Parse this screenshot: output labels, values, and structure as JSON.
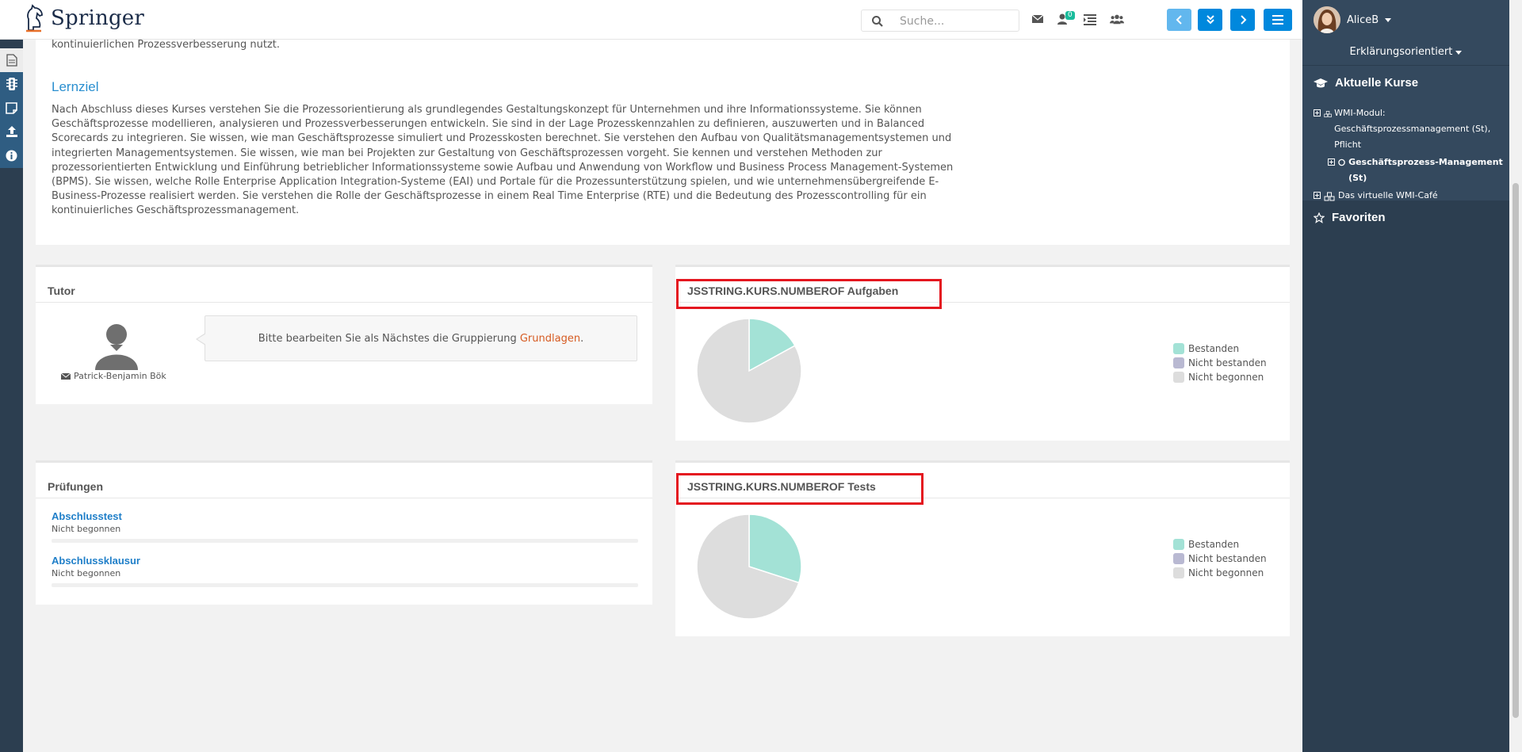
{
  "header": {
    "logo_text": "Springer",
    "search_placeholder": "Suche...",
    "notification_count": "0"
  },
  "intro": {
    "cut_text": "kontinuierlichen Prozessverbesserung nutzt.",
    "heading": "Lernziel",
    "body": "Nach Abschluss dieses Kurses verstehen Sie die Prozessorientierung als grundlegendes Gestaltungskonzept für Unternehmen und ihre Informationssysteme. Sie können Geschäftsprozesse modellieren, analysieren und Prozessverbesserungen entwickeln. Sie sind in der Lage Prozesskennzahlen zu definieren, auszuwerten und in Balanced Scorecards zu integrieren. Sie wissen, wie man Geschäftsprozesse simuliert und Prozesskosten berechnet. Sie verstehen den Aufbau von Qualitätsmanagementsystemen und integrierten Managementsystemen. Sie wissen, wie man bei Projekten zur Gestaltung von Geschäftsprozessen vorgeht. Sie kennen und verstehen Methoden zur prozessorientierten Entwicklung und Einführung betrieblicher Informationssysteme sowie Aufbau und Anwendung von Workflow und Business Process Management-Systemen (BPMS). Sie wissen, welche Rolle Enterprise Application Integration-Systeme (EAI) und Portale für die Prozessunterstützung spielen, und wie unternehmensübergreifende E-Business-Prozesse realisiert werden. Sie verstehen die Rolle der Geschäftsprozesse in einem Real Time Enterprise (RTE) und die Bedeutung des Prozesscontrolling für ein kontinuierliches Geschäftsprozessmanagement."
  },
  "tutor": {
    "title": "Tutor",
    "name": "Patrick-Benjamin Bök",
    "message_prefix": "Bitte bearbeiten Sie als Nächstes die Gruppierung ",
    "message_link": "Grundlagen",
    "message_suffix": "."
  },
  "exams": {
    "title": "Prüfungen",
    "items": [
      {
        "name": "Abschlusstest",
        "status": "Nicht begonnen",
        "progress": 0
      },
      {
        "name": "Abschlussklausur",
        "status": "Nicht begonnen",
        "progress": 0
      }
    ]
  },
  "colors": {
    "passed": "#a3e2d6",
    "failed": "#b9b9d2",
    "not_started": "#dddddd"
  },
  "chart_data": [
    {
      "type": "pie",
      "title": "JSSTRING.KURS.NUMBEROF Aufgaben",
      "categories": [
        "Bestanden",
        "Nicht bestanden",
        "Nicht begonnen"
      ],
      "values": [
        17,
        0,
        83
      ],
      "legend": "right"
    },
    {
      "type": "pie",
      "title": "JSSTRING.KURS.NUMBEROF Tests",
      "categories": [
        "Bestanden",
        "Nicht bestanden",
        "Nicht begonnen"
      ],
      "values": [
        30,
        0,
        70
      ],
      "legend": "right"
    }
  ],
  "sidebar": {
    "user": "AliceB",
    "mode": "Erklärungsorientiert",
    "courses_title": "Aktuelle Kurse",
    "favorites_title": "Favoriten",
    "tree": [
      {
        "label": "WMI-Modul: Geschäftsprozessmanagement (St), Pflicht"
      },
      {
        "label": "Geschäftsprozess-Management (St)"
      },
      {
        "label": "Das virtuelle WMI-Café"
      }
    ]
  }
}
